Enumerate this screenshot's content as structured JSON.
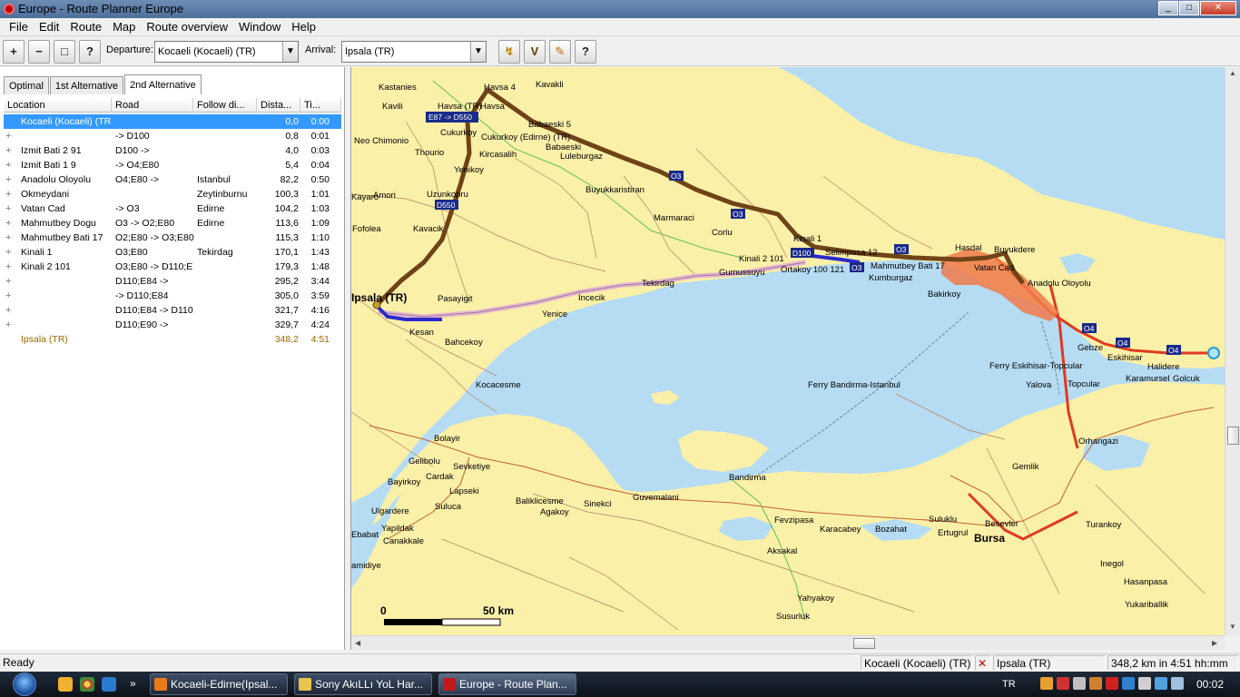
{
  "window": {
    "title": "Europe - Route Planner Europe",
    "btn_min": "_",
    "btn_max": "□",
    "btn_close": "✕"
  },
  "menu": [
    "File",
    "Edit",
    "Route",
    "Map",
    "Route overview",
    "Window",
    "Help"
  ],
  "toolbar": {
    "zoom_in": "+",
    "zoom_out": "−",
    "zoom_window": "□",
    "zoom_custom": "?",
    "departure_label": "Departure:",
    "departure_value": "Kocaeli (Kocaeli) (TR)",
    "arrival_label": "Arrival:",
    "arrival_value": "Ipsala (TR)",
    "route_btn1": "↯",
    "route_btn2": "V",
    "route_btn3": "✎",
    "help_btn": "?"
  },
  "tabs": [
    "Optimal",
    "1st Alternative",
    "2nd Alternative"
  ],
  "active_tab": 2,
  "table": {
    "headers": [
      "Location",
      "Road",
      "Follow di...",
      "Dista...",
      "Ti..."
    ],
    "rows": [
      {
        "loc": "Kocaeli (Kocaeli) (TR",
        "road": "",
        "follow": "",
        "dist": "0,0",
        "time": "0:00",
        "plus": false
      },
      {
        "loc": "",
        "road": "-> D100",
        "follow": "",
        "dist": "0,8",
        "time": "0:01",
        "plus": true
      },
      {
        "loc": "Izmit Bati 2 91",
        "road": "D100 ->",
        "follow": "",
        "dist": "4,0",
        "time": "0:03",
        "plus": true
      },
      {
        "loc": "Izmit Bati 1 9",
        "road": "-> O4;E80",
        "follow": "",
        "dist": "5,4",
        "time": "0:04",
        "plus": true
      },
      {
        "loc": "Anadolu Oloyolu",
        "road": "O4;E80 ->",
        "follow": "Istanbul",
        "dist": "82,2",
        "time": "0:50",
        "plus": true
      },
      {
        "loc": "Okmeydani",
        "road": "",
        "follow": "Zeytinburnu",
        "dist": "100,3",
        "time": "1:01",
        "plus": true
      },
      {
        "loc": "Vatan Cad",
        "road": "-> O3",
        "follow": "Edirne",
        "dist": "104,2",
        "time": "1:03",
        "plus": true
      },
      {
        "loc": "Mahmutbey Dogu",
        "road": "O3 -> O2;E80",
        "follow": "Edirne",
        "dist": "113,6",
        "time": "1:09",
        "plus": true
      },
      {
        "loc": "Mahmutbey Bati 17",
        "road": "O2;E80 -> O3;E80",
        "follow": "",
        "dist": "115,3",
        "time": "1:10",
        "plus": true
      },
      {
        "loc": "Kinali 1",
        "road": "O3;E80",
        "follow": "Tekirdag",
        "dist": "170,1",
        "time": "1:43",
        "plus": true
      },
      {
        "loc": "Kinali 2 101",
        "road": "O3;E80 -> D110;E",
        "follow": "",
        "dist": "179,3",
        "time": "1:48",
        "plus": true
      },
      {
        "loc": "",
        "road": "D110;E84 ->",
        "follow": "",
        "dist": "295,2",
        "time": "3:44",
        "plus": true
      },
      {
        "loc": "",
        "road": "-> D110;E84",
        "follow": "",
        "dist": "305,0",
        "time": "3:59",
        "plus": true
      },
      {
        "loc": "",
        "road": "D110;E84 -> D110",
        "follow": "",
        "dist": "321,7",
        "time": "4:16",
        "plus": true
      },
      {
        "loc": "",
        "road": "D110;E90 ->",
        "follow": "",
        "dist": "329,7",
        "time": "4:24",
        "plus": true
      },
      {
        "loc": "Ipsala (TR)",
        "road": "",
        "follow": "",
        "dist": "348,2",
        "time": "4:51",
        "plus": false
      }
    ]
  },
  "map": {
    "places": [
      {
        "n": "Kastanies"
      },
      {
        "n": "Havsa 4"
      },
      {
        "n": "Kavakli"
      },
      {
        "n": "Havsa (TR)"
      },
      {
        "n": "Havsa"
      },
      {
        "n": "Kavili"
      },
      {
        "n": "Babaeski 5"
      },
      {
        "n": "Neo Chimonio"
      },
      {
        "n": "Cukurkoy"
      },
      {
        "n": "Cukurkoy (Edirne) (TR)"
      },
      {
        "n": "Babaeski"
      },
      {
        "n": "Thourio"
      },
      {
        "n": "Kircasalih"
      },
      {
        "n": "Luleburgaz"
      },
      {
        "n": "Yenikoy"
      },
      {
        "n": "Buyukkaristiran"
      },
      {
        "n": "Amori"
      },
      {
        "n": "Uzunkopru"
      },
      {
        "n": "Marmaraci"
      },
      {
        "n": "Corlu"
      },
      {
        "n": "Kinali 1"
      },
      {
        "n": "Selimpasa 12"
      },
      {
        "n": "Hasdal"
      },
      {
        "n": "Buyukdere"
      },
      {
        "n": "Kavacik"
      },
      {
        "n": "Kinali 2 101"
      },
      {
        "n": "Ortakoy 100 121"
      },
      {
        "n": "Mahmutbey Bati 17"
      },
      {
        "n": "Vatan Cad"
      },
      {
        "n": "Gumussuyu"
      },
      {
        "n": "Kumburgaz"
      },
      {
        "n": "Ipsala (TR)"
      },
      {
        "n": "Pasayigit"
      },
      {
        "n": "Tekirdag"
      },
      {
        "n": "Incecik"
      },
      {
        "n": "Yenice"
      },
      {
        "n": "Bakirkoy"
      },
      {
        "n": "Anadolu Oloyolu"
      },
      {
        "n": "Kesan"
      },
      {
        "n": "Bahcekoy"
      },
      {
        "n": "Gebze"
      },
      {
        "n": "Eskihisar"
      },
      {
        "n": "Ferry Eskihisar-Topcular"
      },
      {
        "n": "Halidere"
      },
      {
        "n": "Kocacesme"
      },
      {
        "n": "Ferry Bandirma-Istanbul"
      },
      {
        "n": "Yalova"
      },
      {
        "n": "Topcular"
      },
      {
        "n": "Karamursel"
      },
      {
        "n": "Golcuk"
      },
      {
        "n": "Bolayir"
      },
      {
        "n": "Orhangazi"
      },
      {
        "n": "Gelibolu"
      },
      {
        "n": "Sevketiye"
      },
      {
        "n": "Gemlik"
      },
      {
        "n": "Bayirkoy"
      },
      {
        "n": "Cardak"
      },
      {
        "n": "Bandirma"
      },
      {
        "n": "Lapseki"
      },
      {
        "n": "Baliklicesme"
      },
      {
        "n": "Sinekci"
      },
      {
        "n": "Guvemalani"
      },
      {
        "n": "Ulgardere"
      },
      {
        "n": "Suluca"
      },
      {
        "n": "Agakoy"
      },
      {
        "n": "Yapildak"
      },
      {
        "n": "Fevzipasa"
      },
      {
        "n": "Karacabey"
      },
      {
        "n": "Bozahat"
      },
      {
        "n": "Suluklu"
      },
      {
        "n": "Ertugrul"
      },
      {
        "n": "Besevler"
      },
      {
        "n": "Turankoy"
      },
      {
        "n": "Bursa"
      },
      {
        "n": "Canakkale"
      },
      {
        "n": "Aksakal"
      },
      {
        "n": "Inegol"
      },
      {
        "n": "Hasanpasa"
      },
      {
        "n": "Yahyakoy"
      },
      {
        "n": "Yukariballik"
      },
      {
        "n": "Susurluk"
      },
      {
        "n": "Fofolea"
      },
      {
        "n": "Kayaro"
      },
      {
        "n": "Ebabat"
      },
      {
        "n": "amidiye"
      }
    ],
    "shields": [
      "E87 -> D550",
      "O3",
      "O3",
      "D550",
      "D100",
      "O3",
      "O3",
      "O4",
      "O4",
      "O4"
    ],
    "scale_start": "0",
    "scale_end": "50 km",
    "colors": {
      "water": "#b5dcf3",
      "land": "#fbf0a8",
      "route": "#7a4a17",
      "motorway": "#e03a1f",
      "alt_route": "#e6b5cf",
      "highlight": "#2b2bcc"
    }
  },
  "status": {
    "ready": "Ready",
    "from": "Kocaeli (Kocaeli) (TR)",
    "to": "Ipsala (TR)",
    "summary": "348,2 km  in 4:51 hh:mm"
  },
  "taskbar": {
    "tasks": [
      "Kocaeli-Edirne(Ipsal...",
      "Sony AkıLLı YoL Har...",
      "Europe - Route Plan..."
    ],
    "lang": "TR",
    "clock": "00:02",
    "more": "»"
  }
}
